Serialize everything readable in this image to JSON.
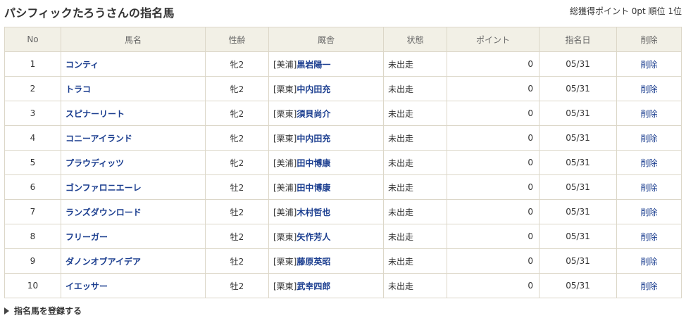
{
  "title": "パシフィックたろうさんの指名馬",
  "summary": "総獲得ポイント 0pt 順位 1位",
  "table": {
    "headers": [
      "No",
      "馬名",
      "性齢",
      "厩舎",
      "状態",
      "ポイント",
      "指名日",
      "削除"
    ],
    "rows": [
      {
        "no": "1",
        "horse": "コンティ",
        "sex": "牝2",
        "stable": "[美浦]",
        "trainer": "黒岩陽一",
        "status": "未出走",
        "points": "0",
        "date": "05/31",
        "delete": "削除"
      },
      {
        "no": "2",
        "horse": "トラコ",
        "sex": "牝2",
        "stable": "[栗東]",
        "trainer": "中内田充",
        "status": "未出走",
        "points": "0",
        "date": "05/31",
        "delete": "削除"
      },
      {
        "no": "3",
        "horse": "スピナーリート",
        "sex": "牝2",
        "stable": "[栗東]",
        "trainer": "須貝尚介",
        "status": "未出走",
        "points": "0",
        "date": "05/31",
        "delete": "削除"
      },
      {
        "no": "4",
        "horse": "コニーアイランド",
        "sex": "牝2",
        "stable": "[栗東]",
        "trainer": "中内田充",
        "status": "未出走",
        "points": "0",
        "date": "05/31",
        "delete": "削除"
      },
      {
        "no": "5",
        "horse": "プラウディッツ",
        "sex": "牝2",
        "stable": "[美浦]",
        "trainer": "田中博康",
        "status": "未出走",
        "points": "0",
        "date": "05/31",
        "delete": "削除"
      },
      {
        "no": "6",
        "horse": "ゴンファロニエーレ",
        "sex": "牡2",
        "stable": "[美浦]",
        "trainer": "田中博康",
        "status": "未出走",
        "points": "0",
        "date": "05/31",
        "delete": "削除"
      },
      {
        "no": "7",
        "horse": "ランズダウンロード",
        "sex": "牡2",
        "stable": "[美浦]",
        "trainer": "木村哲也",
        "status": "未出走",
        "points": "0",
        "date": "05/31",
        "delete": "削除"
      },
      {
        "no": "8",
        "horse": "フリーガー",
        "sex": "牡2",
        "stable": "[栗東]",
        "trainer": "矢作芳人",
        "status": "未出走",
        "points": "0",
        "date": "05/31",
        "delete": "削除"
      },
      {
        "no": "9",
        "horse": "ダノンオブアイデア",
        "sex": "牡2",
        "stable": "[栗東]",
        "trainer": "藤原英昭",
        "status": "未出走",
        "points": "0",
        "date": "05/31",
        "delete": "削除"
      },
      {
        "no": "10",
        "horse": "イエッサー",
        "sex": "牡2",
        "stable": "[栗東]",
        "trainer": "武幸四郎",
        "status": "未出走",
        "points": "0",
        "date": "05/31",
        "delete": "削除"
      }
    ]
  },
  "footer": {
    "register_label": "指名馬を登録する",
    "register_icon": "triangle-right-icon"
  },
  "colors": {
    "header_bg": "#f2f0e6",
    "border": "#dcd7c8",
    "link": "#1a3d8f"
  }
}
